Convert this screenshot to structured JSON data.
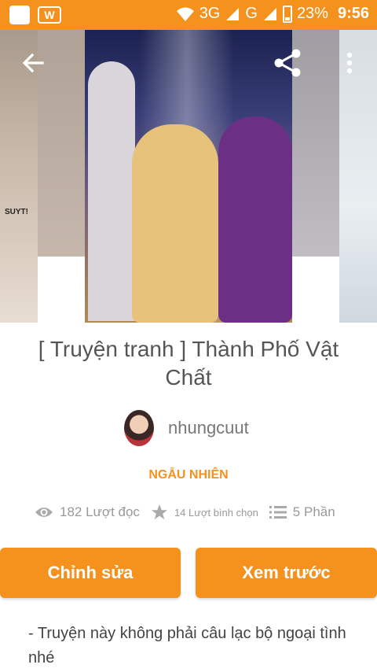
{
  "status_bar": {
    "app_icon_1": "app-square-icon",
    "app_icon_2": "w-app-icon",
    "network": "3G",
    "network2": "G",
    "battery": "23%",
    "time": "9:56"
  },
  "cover": {
    "side_text": "SUYT!"
  },
  "story": {
    "title": "[ Truyện tranh ] Thành Phố Vật Chất",
    "author": "nhungcuut",
    "genre": "NGẪU NHIÊN"
  },
  "stats": {
    "reads": "182 Lượt đọc",
    "votes": "14 Lượt bình chọn",
    "parts": "5 Phần"
  },
  "actions": {
    "edit_label": "Chỉnh sửa",
    "preview_label": "Xem trước"
  },
  "description": "- Truyện này không phải câu lạc bộ ngoại tình nhé",
  "colors": {
    "accent": "#f5921e"
  }
}
